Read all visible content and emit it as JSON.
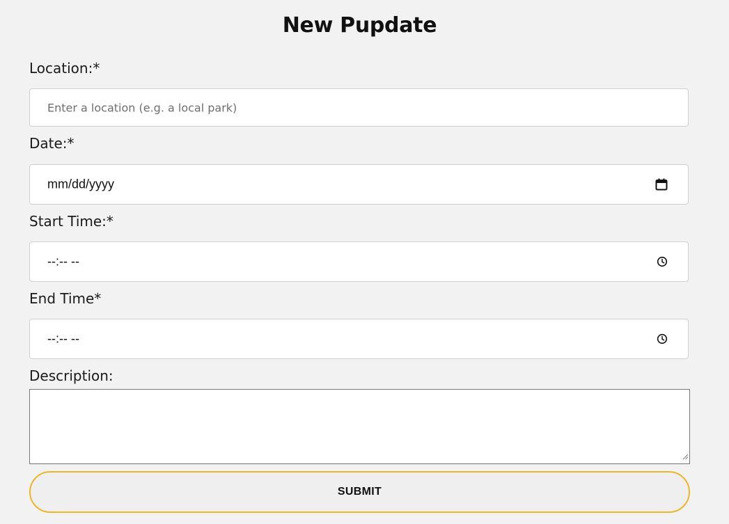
{
  "form": {
    "title": "New Pupdate",
    "location": {
      "label": "Location:*",
      "placeholder": "Enter a location (e.g. a local park)"
    },
    "date": {
      "label": "Date:*",
      "value": "mm/dd/yyyy",
      "icon": "calendar-icon"
    },
    "start_time": {
      "label": "Start Time:*",
      "value": "--:-- --",
      "icon": "clock-icon"
    },
    "end_time": {
      "label": "End Time*",
      "value": "--:-- --",
      "icon": "clock-icon"
    },
    "description": {
      "label": "Description:",
      "value": ""
    },
    "submit_label": "SUBMIT"
  },
  "colors": {
    "background": "#f2f2f2",
    "submit_border": "#f0b429",
    "input_background": "#ffffff"
  }
}
